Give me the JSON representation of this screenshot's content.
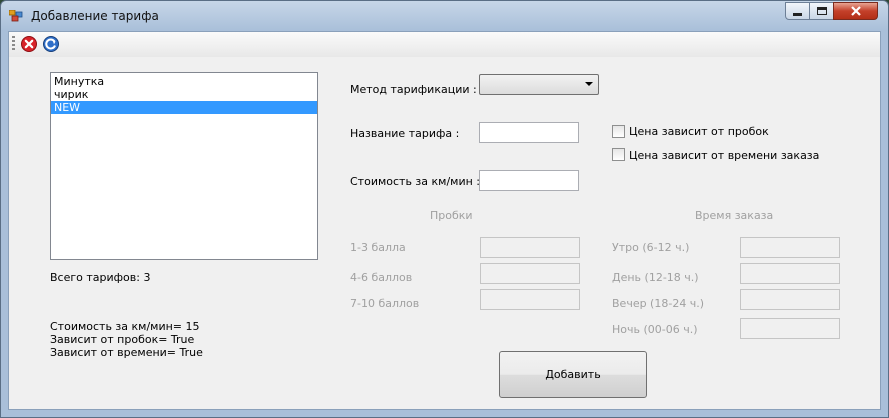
{
  "window": {
    "title": "Добавление тарифа",
    "accent": "#3399ff"
  },
  "toolbar": {
    "buttons": [
      {
        "icon": "close-red-icon"
      },
      {
        "icon": "refresh-blue-icon"
      }
    ]
  },
  "tariff_list": {
    "items": [
      {
        "label": "Минутка",
        "selected": false
      },
      {
        "label": "чирик",
        "selected": false
      },
      {
        "label": "NEW",
        "selected": true
      }
    ],
    "total_label": "Всего тарифов: 3"
  },
  "info": {
    "price_line": "Стоимость за км/мин= 15",
    "traffic_line": "Зависит от пробок= True",
    "time_line": "Зависит от времени= True"
  },
  "form": {
    "method_label": "Метод тарификации :",
    "method_value": "",
    "name_label": "Название тарифа :",
    "name_value": "",
    "cost_label": "Стоимость за км/мин :",
    "cost_value": "",
    "traffic_checkbox": {
      "label": "Цена зависит от пробок",
      "checked": false
    },
    "time_checkbox": {
      "label": "Цена зависит от времени заказа",
      "checked": false
    }
  },
  "traffic": {
    "heading": "Пробки",
    "rows": [
      {
        "label": "1-3 балла",
        "value": ""
      },
      {
        "label": "4-6 баллов",
        "value": ""
      },
      {
        "label": "7-10 баллов",
        "value": ""
      }
    ]
  },
  "order_time": {
    "heading": "Время заказа",
    "rows": [
      {
        "label": "Утро (6-12 ч.)",
        "value": ""
      },
      {
        "label": "День (12-18 ч.)",
        "value": ""
      },
      {
        "label": "Вечер (18-24 ч.)",
        "value": ""
      },
      {
        "label": "Ночь (00-06 ч.)",
        "value": ""
      }
    ]
  },
  "add_button": "Добавить"
}
